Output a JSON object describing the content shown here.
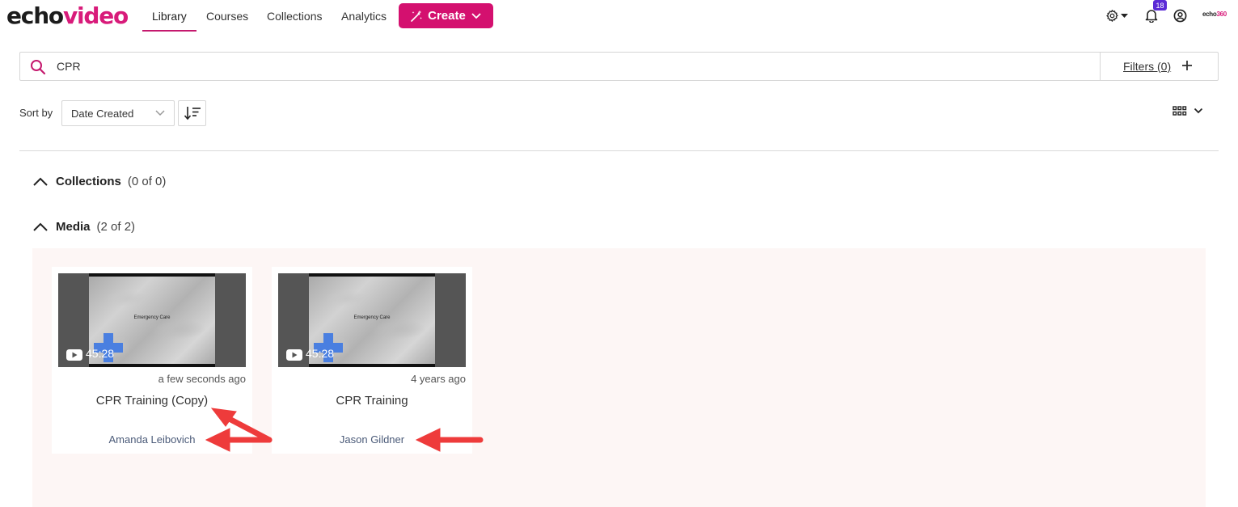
{
  "app": {
    "logo_part1": "echo",
    "logo_part2": "video",
    "brand_small_part1": "echo",
    "brand_small_part2": "360"
  },
  "nav": {
    "items": [
      {
        "label": "Library",
        "active": true
      },
      {
        "label": "Courses"
      },
      {
        "label": "Collections"
      },
      {
        "label": "Analytics"
      }
    ],
    "create_label": "Create",
    "notification_count": "18"
  },
  "search": {
    "value": "CPR",
    "filters_label": "Filters (0)"
  },
  "sort": {
    "label": "Sort by",
    "selected": "Date Created"
  },
  "sections": {
    "collections": {
      "title": "Collections",
      "count": "(0 of 0)"
    },
    "media": {
      "title": "Media",
      "count": "(2 of 2)"
    }
  },
  "media_items": [
    {
      "slide_text": "Emergency Care",
      "duration": "45:28",
      "when": "a few seconds ago",
      "title": "CPR Training (Copy)",
      "owner": "Amanda Leibovich"
    },
    {
      "slide_text": "Emergency Care",
      "duration": "45:28",
      "when": "4 years ago",
      "title": "CPR Training",
      "owner": "Jason Gildner"
    }
  ],
  "colors": {
    "brand": "#d4106f",
    "badge": "#5b2bd6",
    "annotation_arrow": "#ee3b3b"
  },
  "icons": [
    "search-icon",
    "plus-icon",
    "gear-icon",
    "bell-icon",
    "user-circle-icon",
    "chevron-down-icon",
    "sort-order-icon",
    "grid-view-icon",
    "chevron-up-icon",
    "play-icon",
    "wand-icon"
  ]
}
